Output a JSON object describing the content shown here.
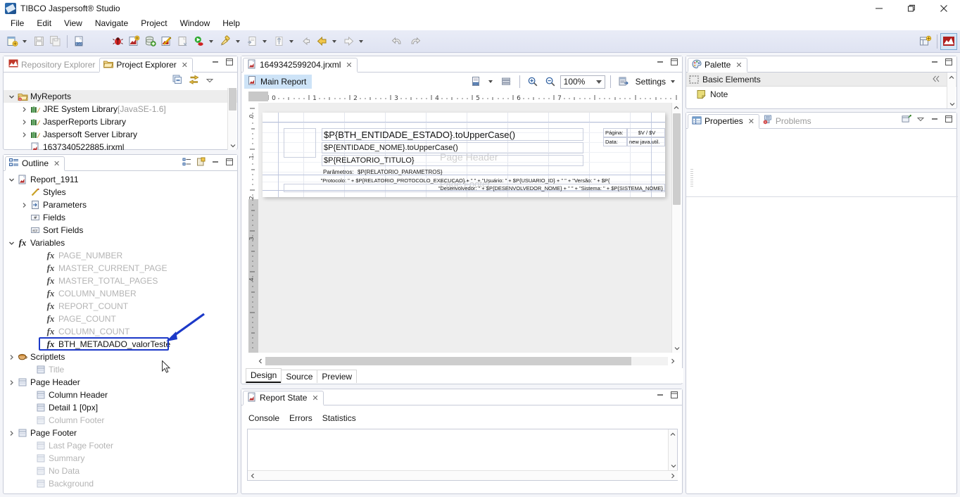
{
  "window": {
    "title": "TIBCO Jaspersoft® Studio",
    "app_icon": "jaspersoft-icon",
    "minimize": "–",
    "maximize": "❐",
    "close": "✕"
  },
  "menubar": {
    "items": [
      "File",
      "Edit",
      "View",
      "Navigate",
      "Project",
      "Window",
      "Help"
    ]
  },
  "toolbar": {
    "icons": [
      "new-file-icon",
      "new-file-dropdown",
      "save-icon",
      "save-all-icon",
      "numeric-010-icon",
      "debug-bug-icon",
      "new-report-icon",
      "new-datasource-icon",
      "new-jrxml-wizard-icon",
      "new-blank-icon",
      "run-icon",
      "run-dropdown",
      "brush-icon",
      "brush-dropdown",
      "export-icon",
      "export-dropdown",
      "import-icon",
      "back-arrow-icon",
      "back-gold-arrow-icon",
      "back-dropdown",
      "forward-arrow-icon",
      "forward-dropdown",
      "undo-icon",
      "redo-icon"
    ],
    "perspective_open": "open-perspective-icon",
    "perspective_active": "jaspersoft-perspective-icon"
  },
  "project_explorer": {
    "tabs": [
      {
        "label": "Repository Explorer",
        "icon": "repository-icon",
        "active": false,
        "closable": false
      },
      {
        "label": "Project Explorer",
        "icon": "project-explorer-icon",
        "active": true,
        "closable": true
      }
    ],
    "tools": [
      "collapse-all-icon",
      "link-with-editor-icon",
      "view-menu-icon"
    ],
    "tree": [
      {
        "label": "MyReports",
        "icon": "project-icon",
        "depth": 0,
        "expanded": true,
        "dim": false,
        "selected": true,
        "suffix": ""
      },
      {
        "label": "JRE System Library",
        "suffix": " [JavaSE-1.6]",
        "icon": "library-icon",
        "depth": 1,
        "expanded": false,
        "dim": false,
        "selected": false
      },
      {
        "label": "JasperReports Library",
        "suffix": "",
        "icon": "library-icon",
        "depth": 1,
        "expanded": false,
        "dim": false,
        "selected": false
      },
      {
        "label": "Jaspersoft Server Library",
        "suffix": "",
        "icon": "library-icon",
        "depth": 1,
        "expanded": false,
        "dim": false,
        "selected": false
      },
      {
        "label": "1637340522885.jrxml",
        "suffix": "",
        "icon": "jrxml-icon",
        "depth": 1,
        "expanded": null,
        "dim": false,
        "selected": false
      }
    ]
  },
  "outline": {
    "tab_label": "Outline",
    "tab_icon": "outline-icon",
    "tools": [
      "sort-tree-icon",
      "filter-icon",
      "minimize-icon",
      "maximize-icon"
    ],
    "tree": [
      {
        "label": "Report_1911",
        "icon": "report-icon",
        "depth": 0,
        "expanded": true,
        "dim": false
      },
      {
        "label": "Styles",
        "icon": "styles-pen-icon",
        "depth": 1,
        "expanded": null,
        "dim": false
      },
      {
        "label": "Parameters",
        "icon": "parameters-icon",
        "depth": 1,
        "expanded": false,
        "dim": false
      },
      {
        "label": "Fields",
        "icon": "fields-icon",
        "depth": 1,
        "expanded": null,
        "dim": false
      },
      {
        "label": "Sort Fields",
        "icon": "sort-fields-icon",
        "depth": 1,
        "expanded": null,
        "dim": false
      },
      {
        "label": "Variables",
        "icon": "fx-icon",
        "depth": 1,
        "expanded": true,
        "dim": false
      },
      {
        "label": "PAGE_NUMBER",
        "icon": "fx-icon",
        "depth": 2,
        "expanded": null,
        "dim": true
      },
      {
        "label": "MASTER_CURRENT_PAGE",
        "icon": "fx-icon",
        "depth": 2,
        "expanded": null,
        "dim": true
      },
      {
        "label": "MASTER_TOTAL_PAGES",
        "icon": "fx-icon",
        "depth": 2,
        "expanded": null,
        "dim": true
      },
      {
        "label": "COLUMN_NUMBER",
        "icon": "fx-icon",
        "depth": 2,
        "expanded": null,
        "dim": true
      },
      {
        "label": "REPORT_COUNT",
        "icon": "fx-icon",
        "depth": 2,
        "expanded": null,
        "dim": true
      },
      {
        "label": "PAGE_COUNT",
        "icon": "fx-icon",
        "depth": 2,
        "expanded": null,
        "dim": true
      },
      {
        "label": "COLUMN_COUNT",
        "icon": "fx-icon",
        "depth": 2,
        "expanded": null,
        "dim": true
      },
      {
        "label": "BTH_METADADO_valorTeste",
        "icon": "fx-icon",
        "depth": 2,
        "expanded": null,
        "dim": false,
        "highlighted": true
      },
      {
        "label": "Scriptlets",
        "icon": "scriptlets-cup-icon",
        "depth": 1,
        "expanded": false,
        "dim": false
      },
      {
        "label": "Title",
        "icon": "band-icon",
        "depth": 1,
        "expanded": null,
        "dim": true
      },
      {
        "label": "Page Header",
        "icon": "band-icon",
        "depth": 1,
        "expanded": false,
        "dim": false
      },
      {
        "label": "Column Header",
        "icon": "band-icon",
        "depth": 1,
        "expanded": null,
        "dim": false
      },
      {
        "label": "Detail 1 [0px]",
        "icon": "band-icon",
        "depth": 1,
        "expanded": null,
        "dim": false
      },
      {
        "label": "Column Footer",
        "icon": "band-icon",
        "depth": 1,
        "expanded": null,
        "dim": true
      },
      {
        "label": "Page Footer",
        "icon": "band-icon",
        "depth": 1,
        "expanded": false,
        "dim": false
      },
      {
        "label": "Last Page Footer",
        "icon": "band-icon",
        "depth": 1,
        "expanded": null,
        "dim": true
      },
      {
        "label": "Summary",
        "icon": "band-icon",
        "depth": 1,
        "expanded": null,
        "dim": true
      },
      {
        "label": "No Data",
        "icon": "band-icon",
        "depth": 1,
        "expanded": null,
        "dim": true
      },
      {
        "label": "Background",
        "icon": "band-icon",
        "depth": 1,
        "expanded": null,
        "dim": true
      }
    ]
  },
  "editor": {
    "tab_label": "1649342599204.jrxml",
    "tab_icon": "jrxml-icon",
    "main_report_tab": "Main Report",
    "main_report_icon": "report-icon",
    "tools": {
      "dataset_icon": "dataset-010-icon",
      "dataset_dropdown": "chevron-down-icon",
      "bands_icon": "bands-icon",
      "zoom_in_icon": "zoom-in-icon",
      "zoom_out_icon": "zoom-out-icon",
      "zoom_value": "100%",
      "settings_icon": "settings-icon",
      "settings_label": "Settings",
      "settings_dropdown": "chevron-down-icon"
    },
    "ruler_h_ticks": [
      "0",
      "1",
      "2",
      "3",
      "4",
      "5",
      "6",
      "7"
    ],
    "ruler_v_ticks": [
      "0",
      "1",
      "2",
      "3",
      "4"
    ],
    "band_labels": [
      "Page Header",
      "Page Footer"
    ],
    "elements": [
      {
        "name": "bth-entidade-estado-field",
        "text": "$P{BTH_ENTIDADE_ESTADO}.toUpperCase()",
        "size": "big"
      },
      {
        "name": "entidade-nome-field",
        "text": "$P{ENTIDADE_NOME}.toUpperCase()",
        "size": "med"
      },
      {
        "name": "relatorio-titulo-field",
        "text": "$P{RELATORIO_TITULO}",
        "size": "med"
      },
      {
        "name": "parametros-label",
        "text": "Parâmetros:",
        "size": "small"
      },
      {
        "name": "relatorio-parametros-field",
        "text": "$P{RELATORIO_PARAMETROS}",
        "size": "small"
      },
      {
        "name": "protocolo-line",
        "text": "\"Protocolo: \" + $P{RELATORIO_PROTOCOLO_EXECUCAO} + \"   \" + \"Usuário: \" + $P{USUARIO_ID} + \"   \" + \"Versão: \" + $P{",
        "size": "small"
      },
      {
        "name": "desenvolvedor-line",
        "text": "\"Desenvolvedor: \" + $P{DESENVOLVEDOR_NOME} + \"   \" + \"Sistema: \" + $P{SISTEMA_NOME}",
        "size": "small"
      },
      {
        "name": "pagina-label",
        "text": "Página:",
        "size": "small"
      },
      {
        "name": "pagina-value",
        "text": "$V /   $V",
        "size": "small"
      },
      {
        "name": "data-label",
        "text": "Data:",
        "size": "small"
      },
      {
        "name": "data-value",
        "text": "new java.util.",
        "size": "small"
      }
    ],
    "bottom_tabs": [
      {
        "label": "Design",
        "active": true
      },
      {
        "label": "Source",
        "active": false
      },
      {
        "label": "Preview",
        "active": false
      }
    ]
  },
  "report_state": {
    "tab_label": "Report State",
    "tab_icon": "report-icon",
    "tabs": [
      "Console",
      "Errors",
      "Statistics"
    ],
    "tools": [
      "minimize-icon",
      "maximize-icon"
    ]
  },
  "palette": {
    "tab_label": "Palette",
    "tab_icon": "palette-icon",
    "tools": [
      "minimize-icon",
      "maximize-icon"
    ],
    "section": "Basic Elements",
    "section_icon": "dashed-box-icon",
    "collapse_icon": "collapse-section-icon",
    "items": [
      {
        "label": "Note",
        "icon": "note-icon"
      }
    ]
  },
  "properties": {
    "tabs": [
      {
        "label": "Properties",
        "icon": "properties-icon",
        "active": true,
        "closable": true
      },
      {
        "label": "Problems",
        "icon": "problems-icon",
        "active": false,
        "closable": false
      }
    ],
    "tools": [
      "pin-icon",
      "view-menu-icon",
      "minimize-icon",
      "maximize-icon"
    ]
  },
  "annotation": {
    "highlight_target": "BTH_METADADO_valorTeste",
    "color": "#1c39c8"
  }
}
